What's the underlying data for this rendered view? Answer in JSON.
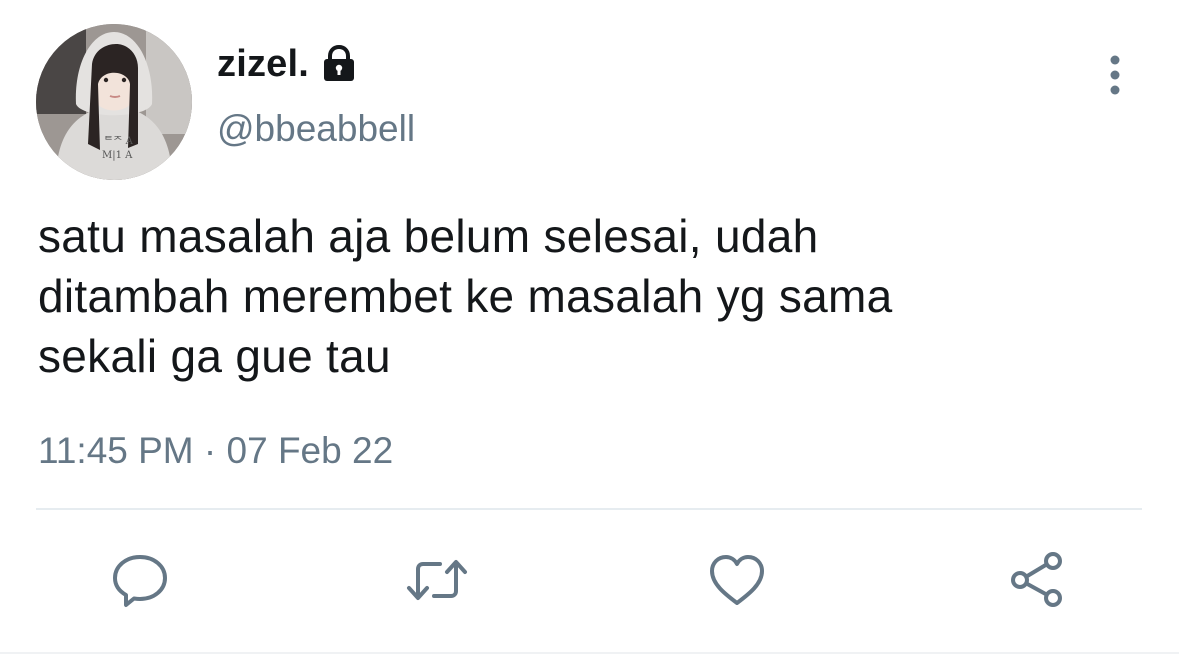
{
  "author": {
    "display_name": "zizel.",
    "handle": "@bbeabbell",
    "protected": true,
    "avatar_icon": "profile-photo"
  },
  "tweet": {
    "lines": [
      "satu masalah aja belum selesai, udah",
      "ditambah merembet ke masalah yg sama",
      "sekali ga gue tau"
    ],
    "time": "11:45 PM",
    "separator": "·",
    "date": "07 Feb 22"
  },
  "actions": {
    "reply_icon": "reply-icon",
    "retweet_icon": "retweet-icon",
    "like_icon": "heart-icon",
    "share_icon": "share-icon",
    "more_icon": "more-vertical-icon"
  },
  "colors": {
    "text": "#14171a",
    "secondary": "#657786",
    "icon": "#657786",
    "divider": "#e6ecf0"
  }
}
